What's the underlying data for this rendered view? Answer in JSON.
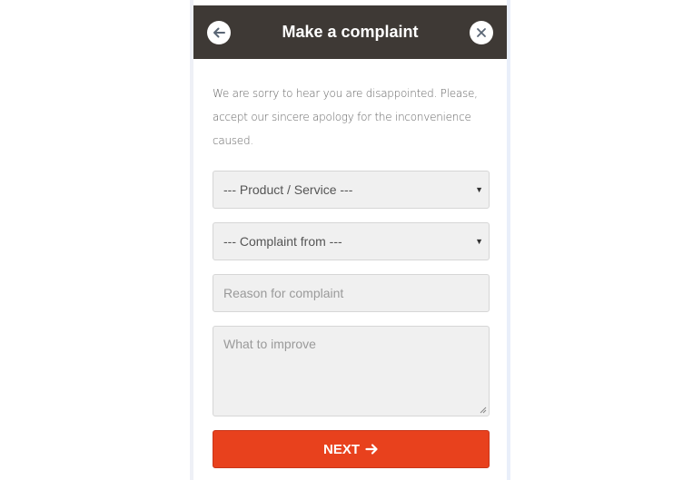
{
  "header": {
    "title": "Make a complaint",
    "back_icon": "arrow-left-icon",
    "close_icon": "close-icon",
    "background": "#3e3935"
  },
  "intro_text": "We are sorry to hear you are disappointed. Please, accept our sincere apology for the inconvenience caused.",
  "form": {
    "product_select": {
      "value": "--- Product / Service ---"
    },
    "complaint_from_select": {
      "value": "--- Complaint from ---"
    },
    "reason_input": {
      "placeholder": "Reason for complaint",
      "value": ""
    },
    "improve_textarea": {
      "placeholder": "What to improve",
      "value": ""
    }
  },
  "next_button": {
    "label": "NEXT",
    "icon": "arrow-right-icon",
    "color": "#e8411d"
  }
}
